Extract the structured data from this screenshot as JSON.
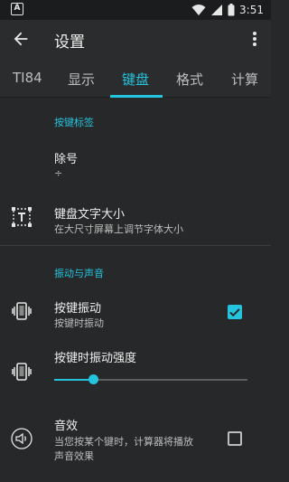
{
  "status_bar": {
    "notification_icon": "A",
    "icons": [
      "wifi-icon",
      "signal-icon",
      "battery-icon"
    ],
    "time": "3:51"
  },
  "app_bar": {
    "title": "设置",
    "back_icon": "arrow-back-icon",
    "menu_icon": "more-vert-icon"
  },
  "tabs": [
    {
      "label": "TI84"
    },
    {
      "label": "显示"
    },
    {
      "label": "键盘",
      "active": true
    },
    {
      "label": "格式"
    },
    {
      "label": "计算"
    }
  ],
  "sections": {
    "keys_label": {
      "header": "按键标签",
      "divide": {
        "title": "除号",
        "value": "÷"
      },
      "font_size": {
        "title": "键盘文字大小",
        "subtitle": "在大尺寸屏幕上调节字体大小",
        "icon": "text-size-icon"
      }
    },
    "vibration_sound": {
      "header": "振动与声音",
      "key_vibration": {
        "title": "按键振动",
        "subtitle": "按键时振动",
        "checked": true,
        "icon": "vibration-icon"
      },
      "vibration_strength": {
        "title": "按键时振动强度",
        "level": 0.2,
        "icon": "vibration-icon"
      },
      "sound": {
        "title": "音效",
        "subtitle_line1": "当您按某个键时，计算器将播放",
        "subtitle_line2": "声音效果",
        "checked": false,
        "icon": "volume-icon"
      }
    }
  },
  "colors": {
    "accent": "#25c4de",
    "background": "#262829",
    "app_bar": "#2a2c2d"
  }
}
